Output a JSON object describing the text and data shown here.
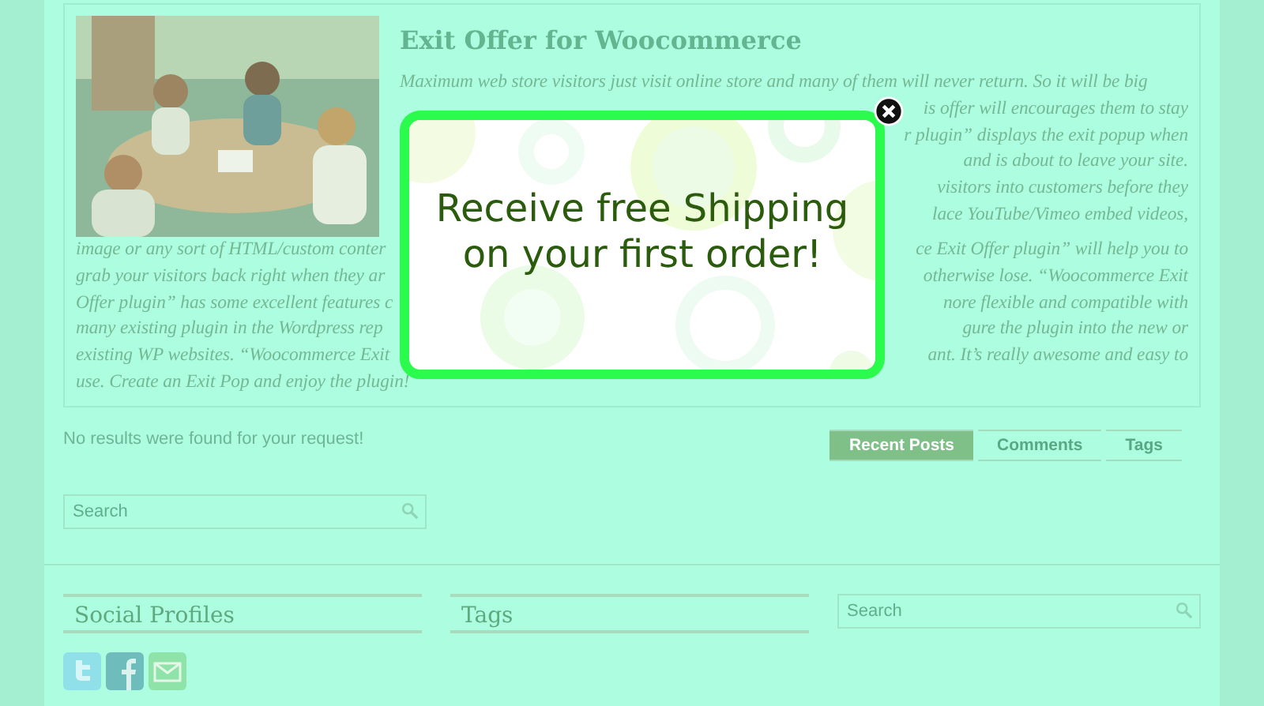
{
  "article": {
    "title": "Exit Offer for Woocommerce",
    "side_lines": [
      {
        "left": "Maximum web store visitors just visit online store and many of them will never return. So it will be big"
      },
      {
        "right": "is offer will encourages them to stay"
      },
      {
        "right": "r plugin” displays the exit popup when"
      },
      {
        "right": "and is about to leave your site."
      },
      {
        "right": "visitors into customers before they"
      },
      {
        "right": "lace YouTube/Vimeo embed videos,"
      }
    ],
    "lines": [
      {
        "left": "image or any sort of HTML/custom conter",
        "right": "ce Exit Offer plugin” will help you to"
      },
      {
        "left": "grab your visitors back right when they ar",
        "right": "otherwise lose. “Woocommerce Exit"
      },
      {
        "left": "Offer plugin” has some excellent features c",
        "right": "nore flexible and compatible with"
      },
      {
        "left": "many existing plugin in the Wordpress rep",
        "right": "gure the plugin into the new or"
      },
      {
        "left": "existing WP websites. “Woocommerce Exit",
        "right": "ant. It’s really awesome and easy to"
      },
      {
        "left": "use. Create an Exit Pop and enjoy the plugin!"
      }
    ]
  },
  "no_results": "No results were found for your request!",
  "tabs": [
    {
      "label": "Recent Posts",
      "selected": true
    },
    {
      "label": "Comments",
      "selected": false
    },
    {
      "label": "Tags",
      "selected": false
    }
  ],
  "search": {
    "placeholder": "Search"
  },
  "footer": {
    "social_title": "Social Profiles",
    "social_links": [
      {
        "kind": "twitter"
      },
      {
        "kind": "facebook"
      },
      {
        "kind": "mail"
      }
    ],
    "tags_title": "Tags",
    "search": {
      "placeholder": "Search"
    }
  },
  "popup": {
    "headline": [
      "Receive free Shipping",
      "on your first order!"
    ]
  }
}
